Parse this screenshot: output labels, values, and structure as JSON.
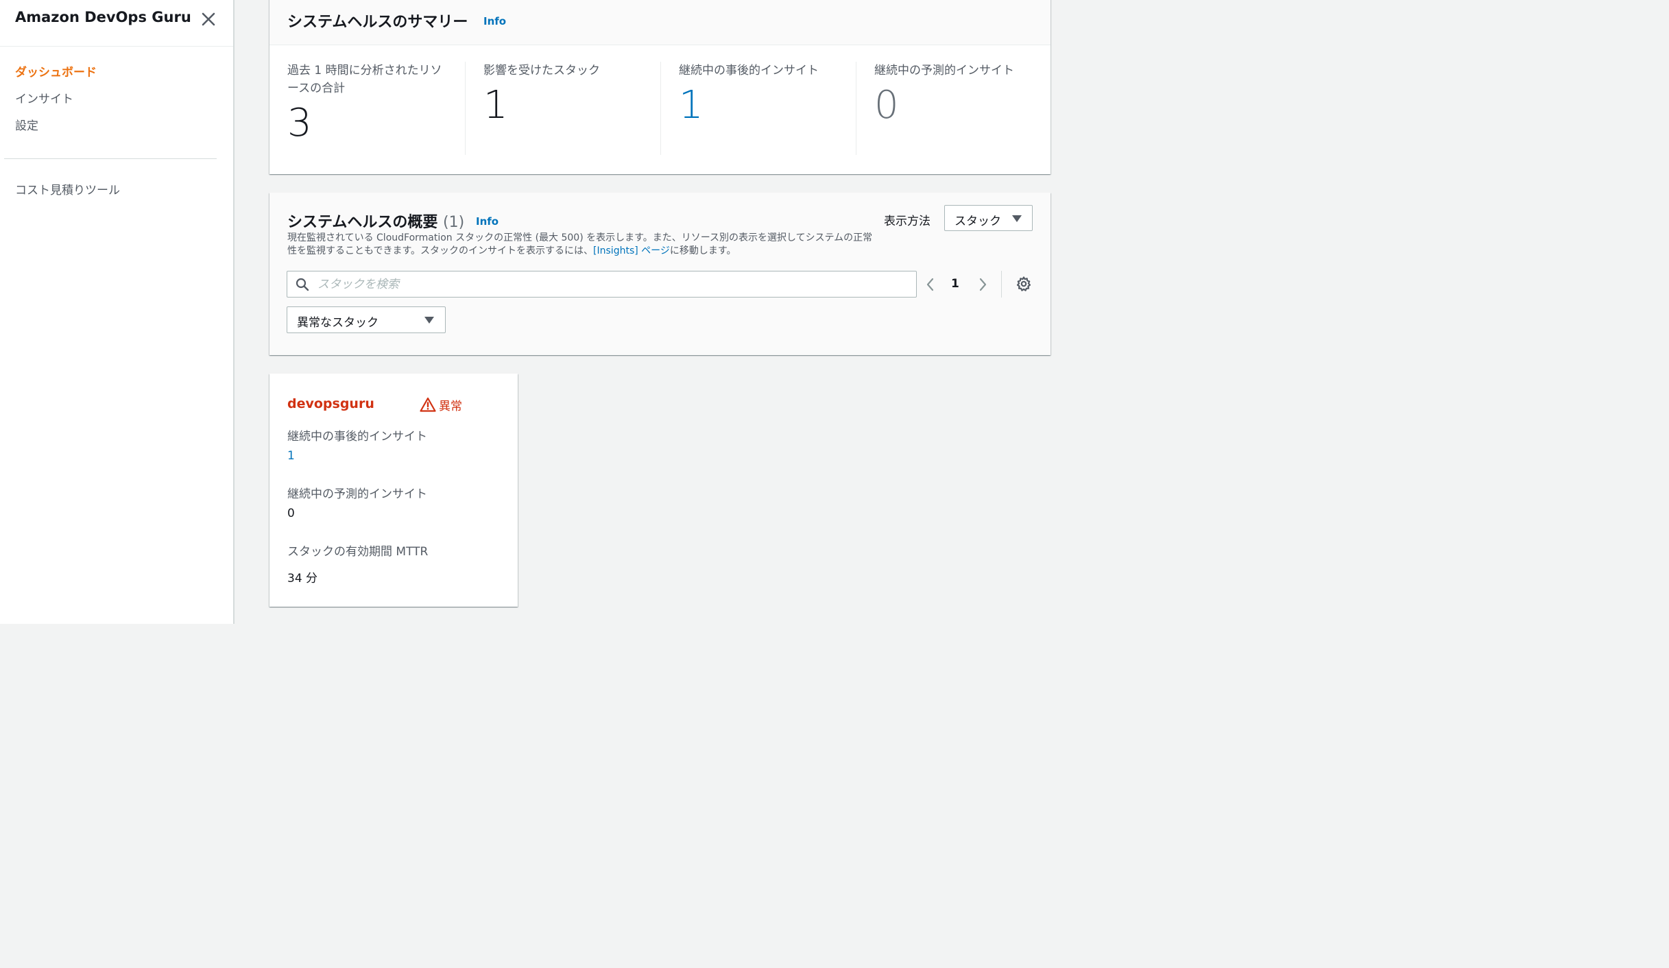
{
  "sidebar": {
    "title": "Amazon DevOps Guru",
    "nav": [
      {
        "label": "ダッシュボード",
        "active": true
      },
      {
        "label": "インサイト",
        "active": false
      },
      {
        "label": "設定",
        "active": false
      }
    ],
    "tool": "コスト見積りツール"
  },
  "summary": {
    "title": "システムヘルスのサマリー",
    "info": "Info",
    "stats": [
      {
        "label": "過去 1 時間に分析されたリソースの合計",
        "value": "3",
        "color": "#16191f"
      },
      {
        "label": "影響を受けたスタック",
        "value": "1",
        "color": "#16191f"
      },
      {
        "label": "継続中の事後的インサイト",
        "value": "1",
        "color": "#0073bb"
      },
      {
        "label": "継続中の予測的インサイト",
        "value": "0",
        "color": "#687078"
      }
    ]
  },
  "overview": {
    "title": "システムヘルスの概要",
    "count": "(1)",
    "info": "Info",
    "desc_part1": "現在監視されている CloudFormation スタックの正常性 (最大 500) を表示します。また、リソース別の表示を選択してシステムの正常性を監視することもできます。スタックのインサイトを表示するには、",
    "desc_link": "[Insights] ページ",
    "desc_part2": "に移動します。",
    "view_label": "表示方法",
    "view_value": "スタック",
    "search_placeholder": "スタックを検索",
    "page": "1",
    "filter_value": "異常なスタック"
  },
  "card": {
    "name": "devopsguru",
    "status": "異常",
    "reactive_label": "継続中の事後的インサイト",
    "reactive_value": "1",
    "proactive_label": "継続中の予測的インサイト",
    "proactive_value": "0",
    "mttr_label": "スタックの有効期間 MTTR",
    "mttr_value": "34 分"
  },
  "colors": {
    "accent": "#ec7211",
    "link": "#0073bb",
    "error": "#d13212"
  }
}
